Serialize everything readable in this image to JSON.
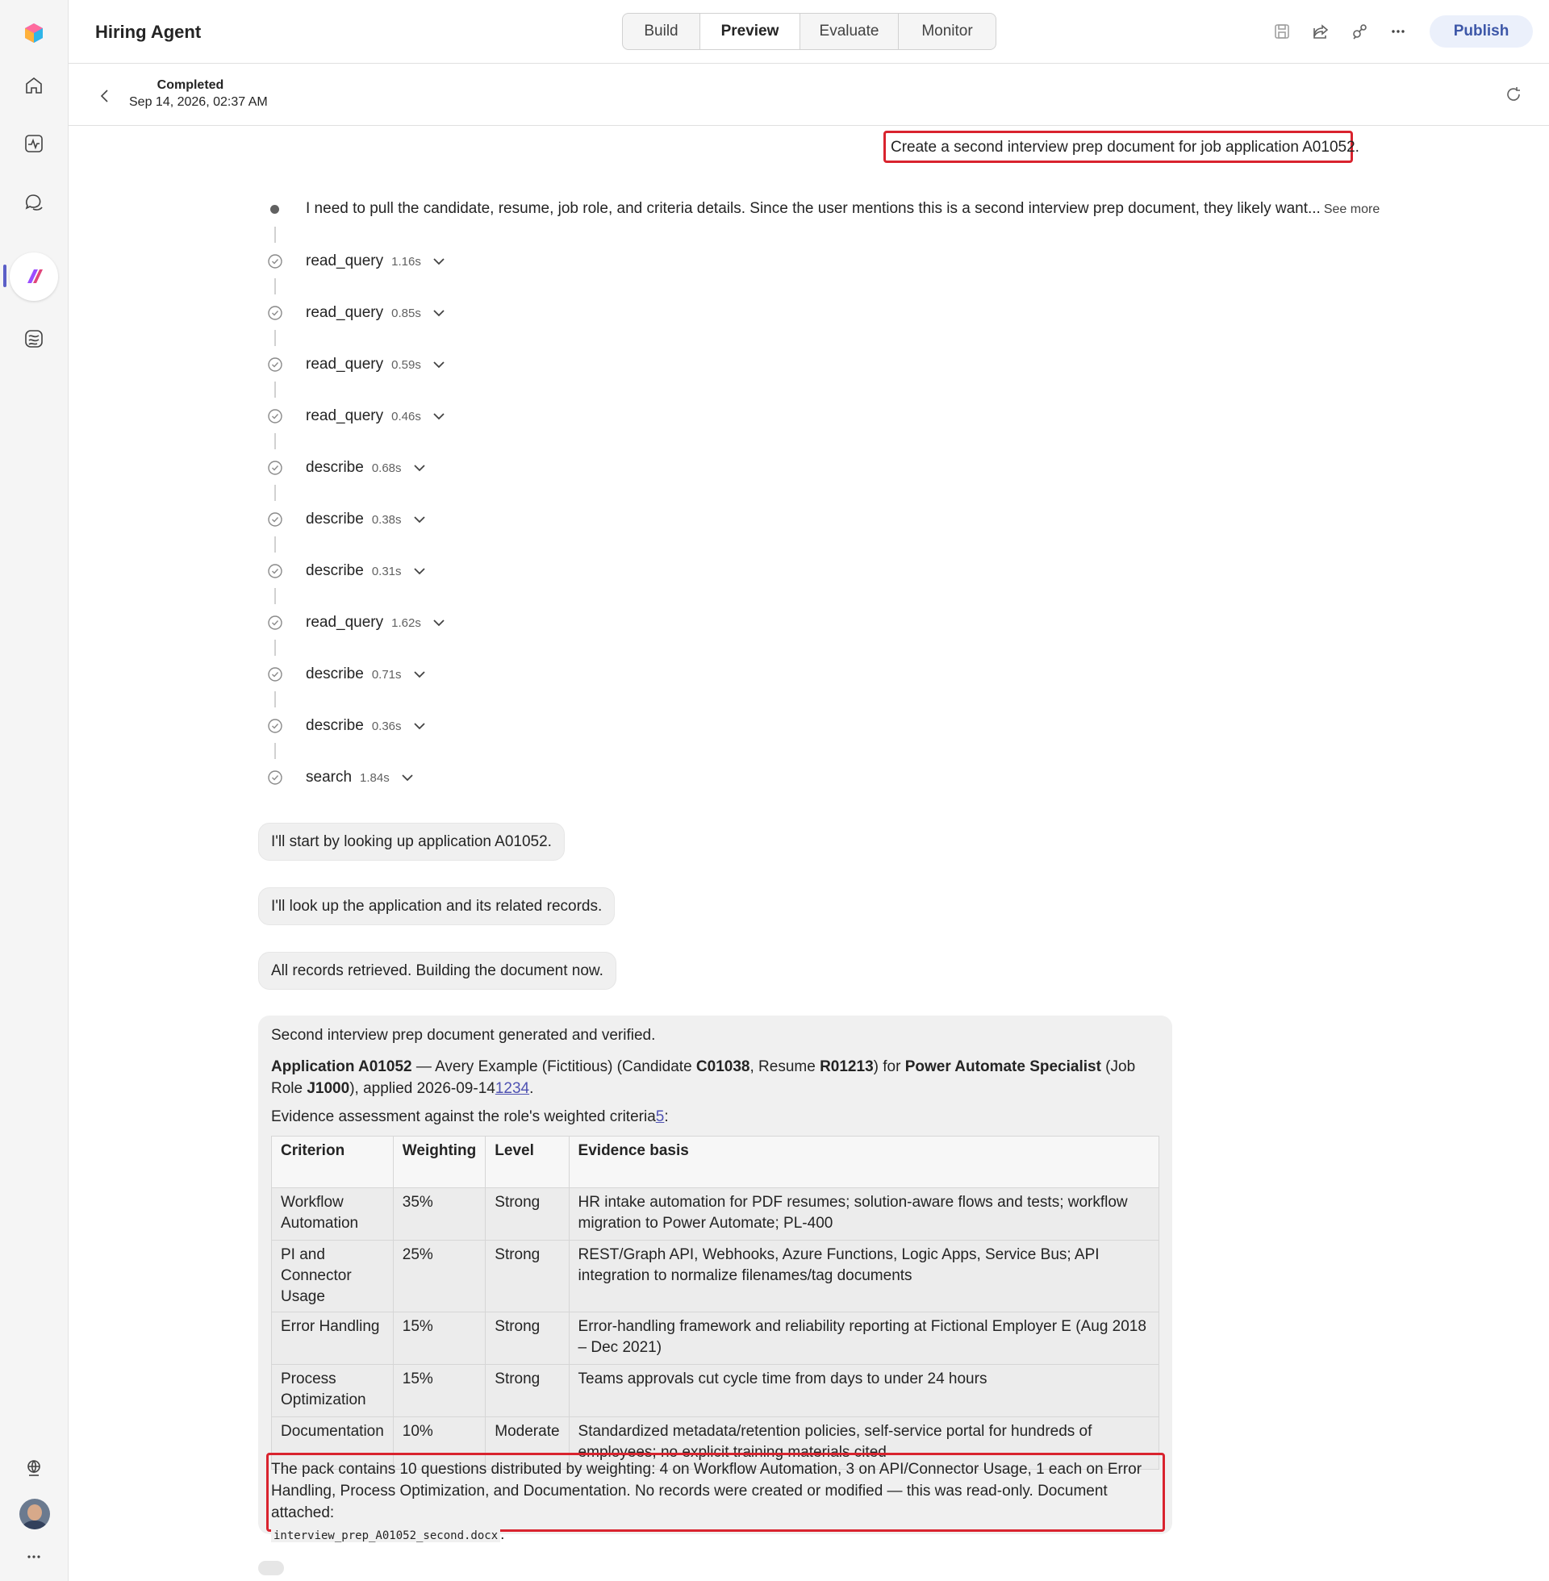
{
  "app": {
    "title": "Hiring Agent",
    "publish_label": "Publish"
  },
  "tabs": [
    "Build",
    "Preview",
    "Evaluate",
    "Monitor"
  ],
  "active_tab": "Preview",
  "run": {
    "status": "Completed",
    "timestamp": "Sep 14, 2026, 02:37 AM"
  },
  "user_message": "Create a second interview prep document for job application A01052.",
  "thought": {
    "text": "I need to pull the candidate, resume, job role, and criteria details. Since the user mentions this is a second interview prep document, they likely want...",
    "see_more": "See more"
  },
  "steps": [
    {
      "name": "read_query",
      "time": "1.16s"
    },
    {
      "name": "read_query",
      "time": "0.85s"
    },
    {
      "name": "read_query",
      "time": "0.59s"
    },
    {
      "name": "read_query",
      "time": "0.46s"
    },
    {
      "name": "describe",
      "time": "0.68s"
    },
    {
      "name": "describe",
      "time": "0.38s"
    },
    {
      "name": "describe",
      "time": "0.31s"
    },
    {
      "name": "read_query",
      "time": "1.62s"
    },
    {
      "name": "describe",
      "time": "0.71s"
    },
    {
      "name": "describe",
      "time": "0.36s"
    },
    {
      "name": "search",
      "time": "1.84s"
    }
  ],
  "agent_messages": [
    "I'll start by looking up application A01052.",
    "I'll look up the application and its related records.",
    "All records retrieved. Building the document now."
  ],
  "answer": {
    "intro": "Second interview prep document generated and verified.",
    "application_id": "Application A01052",
    "text_1": " — Avery Example (Fictitious) (Candidate ",
    "candidate_id": "C01038",
    "text_2": ", Resume ",
    "resume_id": "R01213",
    "text_3": ") for ",
    "role_name": "Power Automate Specialist",
    "text_4": " (Job Role ",
    "role_id": "J1000",
    "text_5": "), applied 2026-09-14",
    "citations_1": "1234",
    "text_6": ".",
    "evidence_intro": "Evidence assessment against the role's weighted criteria",
    "citation_2": "5",
    "evidence_end": ":",
    "table": {
      "headers": [
        "Criterion",
        "Weighting",
        "Level",
        "Evidence basis"
      ],
      "rows": [
        [
          "Workflow Automation",
          "35%",
          "Strong",
          "HR intake automation for PDF resumes; solution-aware flows and tests; workflow migration to Power Automate; PL-400"
        ],
        [
          "PI and Connector Usage",
          "25%",
          "Strong",
          "REST/Graph API, Webhooks, Azure Functions, Logic Apps, Service Bus; API integration to normalize filenames/tag documents"
        ],
        [
          "Error Handling",
          "15%",
          "Strong",
          "Error-handling framework and reliability reporting at Fictional Employer E (Aug 2018 – Dec 2021)"
        ],
        [
          "Process Optimization",
          "15%",
          "Strong",
          "Teams approvals cut cycle time from days to under 24 hours"
        ],
        [
          "Documentation",
          "10%",
          "Moderate",
          "Standardized metadata/retention policies, self-service portal for hundreds of employees; no explicit training materials cited"
        ]
      ]
    },
    "summary": "The pack contains 10 questions distributed by weighting: 4 on Workflow Automation, 3 on API/Connector Usage, 1 each on Error Handling, Process Optimization, and Documentation. No records were created or modified — this was read-only. Document attached: ",
    "attachment": "interview_prep_A01052_second.docx",
    "summary_end": "."
  },
  "colors": {
    "accent": "#5b5fc7",
    "highlight_border": "#d9232e",
    "publish_bg": "#ebf0fb",
    "publish_text": "#3d57a8"
  }
}
